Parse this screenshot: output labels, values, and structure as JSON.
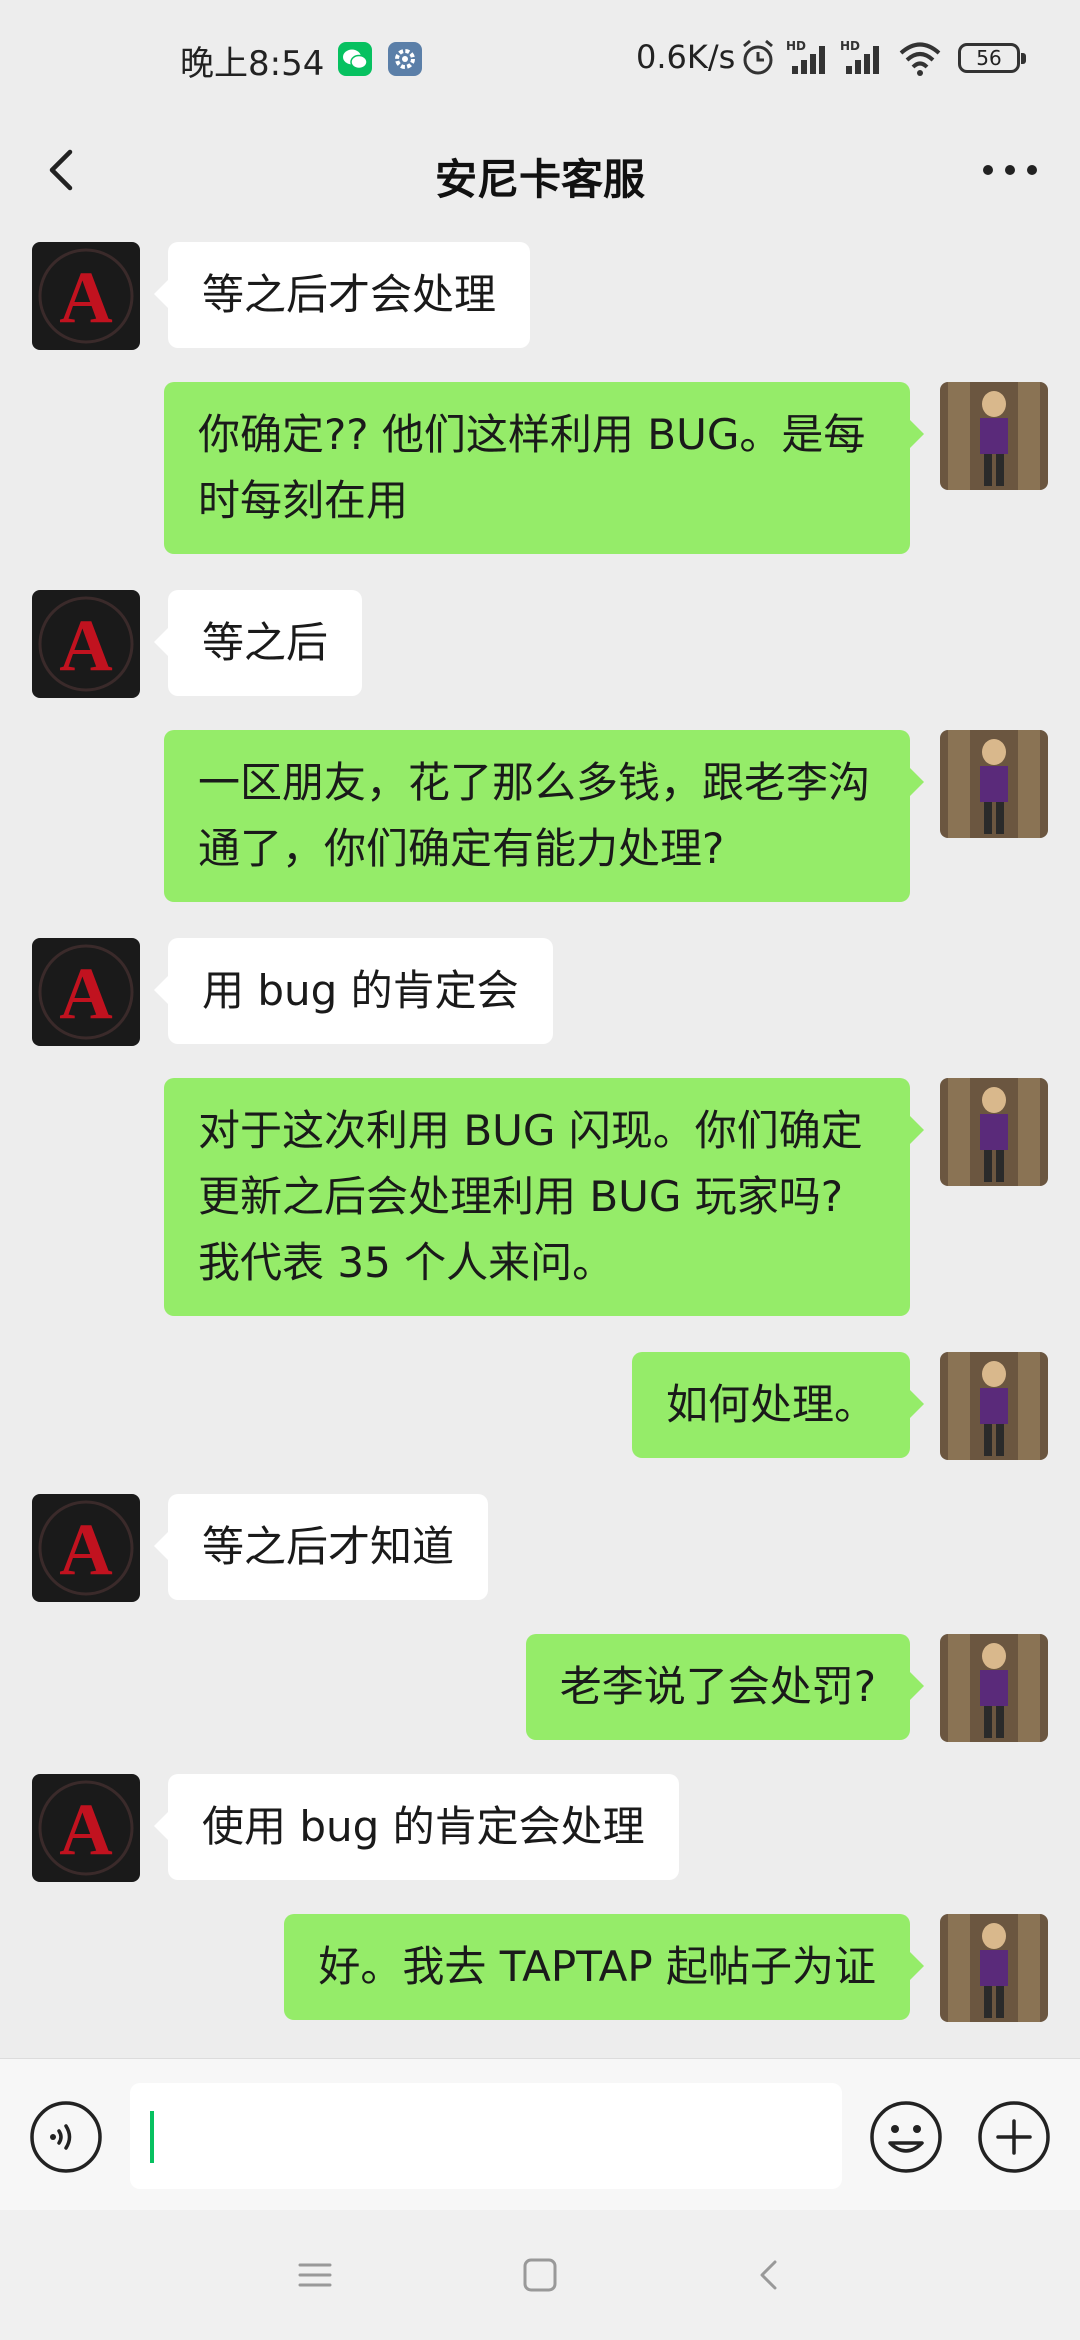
{
  "status_bar": {
    "time": "晚上8:54",
    "net_speed": "0.6K/s",
    "battery": "56",
    "icons": [
      "wechat-icon",
      "settings-gear-icon",
      "alarm-icon",
      "hd-signal-icon",
      "hd-signal-icon",
      "wifi-icon",
      "battery-icon"
    ]
  },
  "header": {
    "title": "安尼卡客服",
    "back_icon": "chevron-left-icon",
    "more_icon": "more-dots-icon"
  },
  "messages": [
    {
      "side": "left",
      "text": "等之后才会处理"
    },
    {
      "side": "right",
      "text": "你确定?? 他们这样利用 BUG。是每时每刻在用"
    },
    {
      "side": "left",
      "text": "等之后"
    },
    {
      "side": "right",
      "text": "一区朋友，花了那么多钱，跟老李沟通了，你们确定有能力处理?"
    },
    {
      "side": "left",
      "text": "用 bug 的肯定会"
    },
    {
      "side": "right",
      "text": "对于这次利用 BUG 闪现。你们确定更新之后会处理利用 BUG 玩家吗?我代表 35 个人来问。"
    },
    {
      "side": "right",
      "text": "如何处理。"
    },
    {
      "side": "left",
      "text": "等之后才知道"
    },
    {
      "side": "right",
      "text": "老李说了会处罚?"
    },
    {
      "side": "left",
      "text": "使用 bug 的肯定会处理"
    },
    {
      "side": "right",
      "text": "好。我去 TAPTAP 起帖子为证"
    }
  ],
  "input_bar": {
    "value": "",
    "icons": [
      "voice-icon",
      "emoji-icon",
      "plus-icon"
    ]
  },
  "nav_bar": {
    "icons": [
      "menu-icon",
      "home-icon",
      "back-icon"
    ]
  },
  "colors": {
    "background": "#ededed",
    "sent_bubble": "#95ec69",
    "received_bubble": "#ffffff",
    "caret": "#07c160"
  }
}
